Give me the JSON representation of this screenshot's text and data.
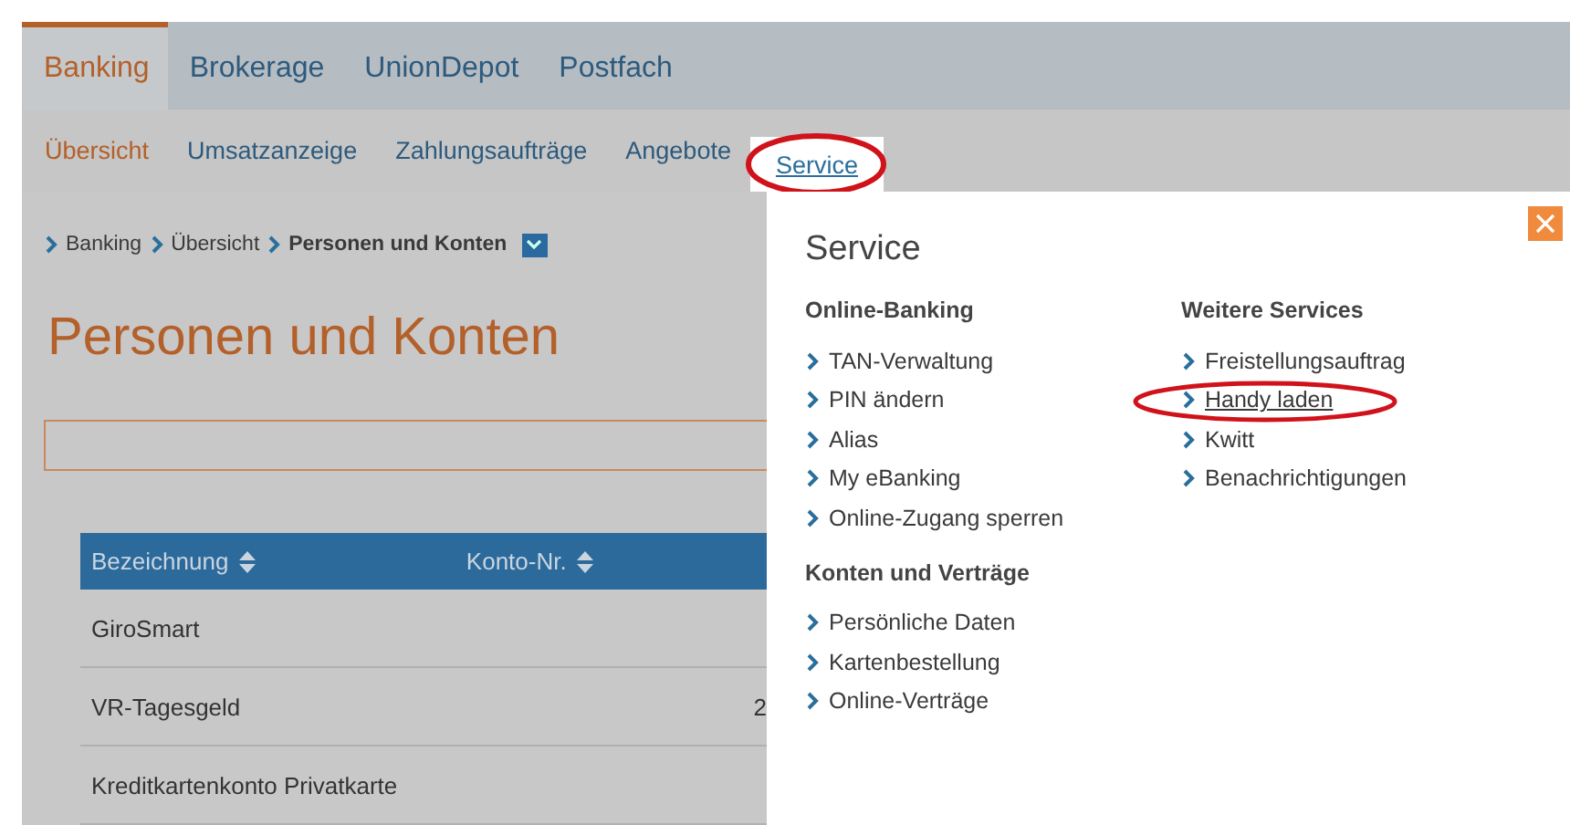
{
  "main_nav": [
    {
      "label": "Banking",
      "selected": true
    },
    {
      "label": "Brokerage",
      "selected": false
    },
    {
      "label": "UnionDepot",
      "selected": false
    },
    {
      "label": "Postfach",
      "selected": false
    }
  ],
  "sub_nav": [
    {
      "label": "Übersicht",
      "selected": true,
      "open": false
    },
    {
      "label": "Umsatzanzeige",
      "selected": false,
      "open": false
    },
    {
      "label": "Zahlungsaufträge",
      "selected": false,
      "open": false
    },
    {
      "label": "Angebote",
      "selected": false,
      "open": false
    },
    {
      "label": "Service",
      "selected": false,
      "open": true
    }
  ],
  "breadcrumb": [
    {
      "label": "Banking",
      "current": false
    },
    {
      "label": "Übersicht",
      "current": false
    },
    {
      "label": "Personen und Konten",
      "current": true
    }
  ],
  "page_title": "Personen und Konten",
  "table": {
    "columns": [
      "Bezeichnung",
      "Konto-Nr."
    ],
    "rows": [
      {
        "name": "GiroSmart",
        "column_3": ""
      },
      {
        "name": "VR-Tagesgeld",
        "column_3": "2"
      },
      {
        "name": "Kreditkartenkonto Privatkarte",
        "column_3": ""
      }
    ]
  },
  "service_menu": {
    "title": "Service",
    "groups": [
      {
        "heading": "Online-Banking",
        "items": [
          {
            "label": "TAN-Verwaltung",
            "hovered": false
          },
          {
            "label": "PIN ändern",
            "hovered": false
          },
          {
            "label": "Alias",
            "hovered": false
          },
          {
            "label": "My eBanking",
            "hovered": false
          },
          {
            "label": "Online-Zugang sperren",
            "hovered": false
          }
        ]
      },
      {
        "heading": "Weitere Services",
        "items": [
          {
            "label": "Freistellungsauftrag",
            "hovered": false
          },
          {
            "label": "Handy laden",
            "hovered": true
          },
          {
            "label": "Kwitt",
            "hovered": false
          },
          {
            "label": "Benachrichtigungen",
            "hovered": false
          }
        ]
      },
      {
        "heading": "Konten und Verträge",
        "items": [
          {
            "label": "Persönliche Daten",
            "hovered": false
          },
          {
            "label": "Kartenbestellung",
            "hovered": false
          },
          {
            "label": "Online-Verträge",
            "hovered": false
          }
        ]
      }
    ]
  }
}
